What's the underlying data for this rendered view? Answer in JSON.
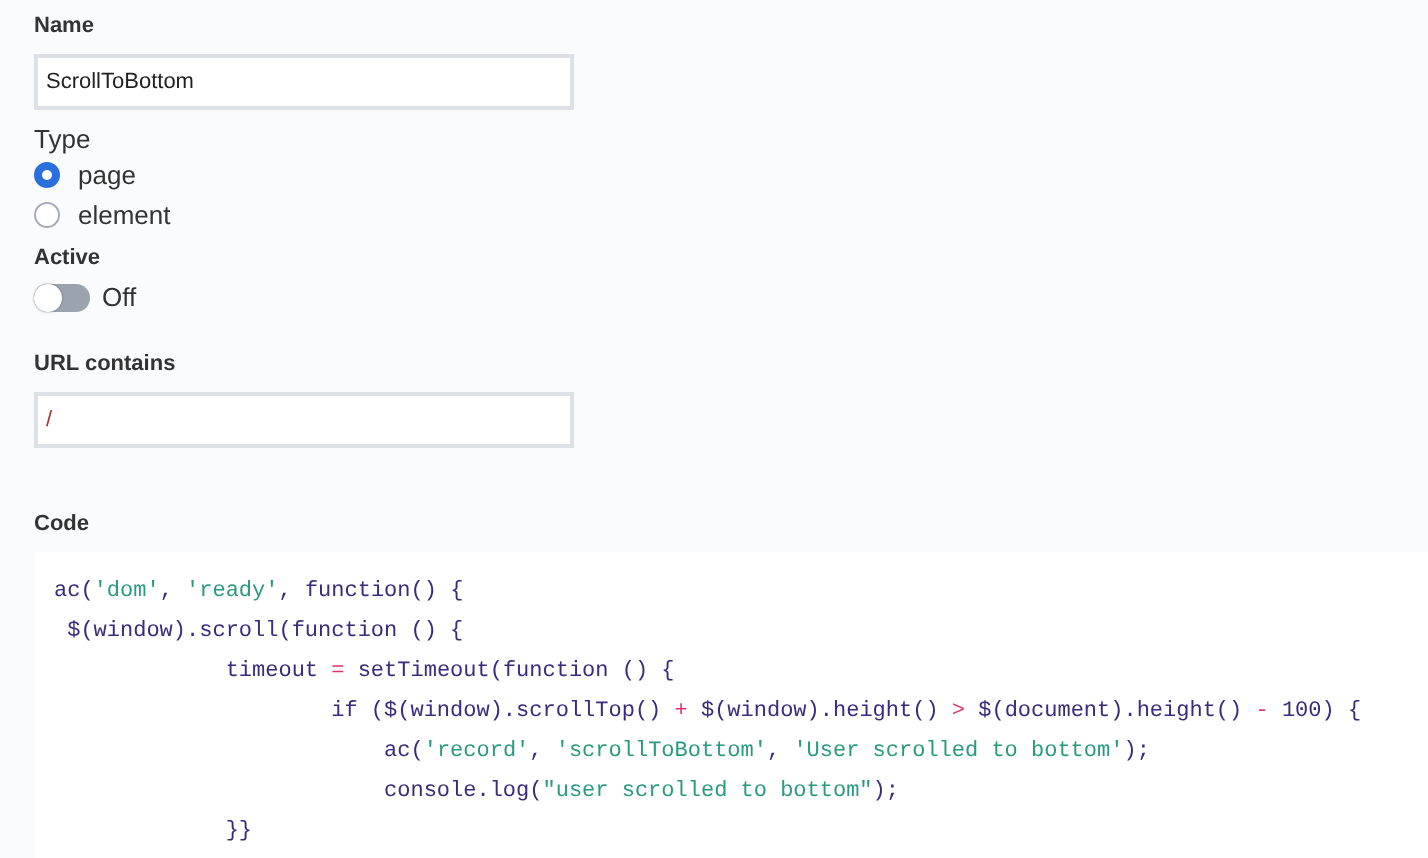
{
  "name_field": {
    "label": "Name",
    "value": "ScrollToBottom"
  },
  "type": {
    "label": "Type",
    "options": [
      {
        "label": "page",
        "selected": true
      },
      {
        "label": "element",
        "selected": false
      }
    ]
  },
  "active": {
    "label": "Active",
    "on": false,
    "state_text": "Off"
  },
  "url_field": {
    "label": "URL contains",
    "value": "/"
  },
  "code": {
    "label": "Code",
    "lines": [
      [
        {
          "text": "ac(",
          "kind": "plain"
        },
        {
          "text": "'dom'",
          "kind": "string"
        },
        {
          "text": ", ",
          "kind": "plain"
        },
        {
          "text": "'ready'",
          "kind": "string"
        },
        {
          "text": ", function() {",
          "kind": "plain"
        }
      ],
      [
        {
          "text": " $(window).scroll(function () {",
          "kind": "plain"
        }
      ],
      [
        {
          "text": "             timeout ",
          "kind": "plain"
        },
        {
          "text": "=",
          "kind": "operator"
        },
        {
          "text": " setTimeout(function () {",
          "kind": "plain"
        }
      ],
      [
        {
          "text": "                     if ($(window).scrollTop() ",
          "kind": "plain"
        },
        {
          "text": "+",
          "kind": "operator"
        },
        {
          "text": " $(window).height() ",
          "kind": "plain"
        },
        {
          "text": ">",
          "kind": "operator"
        },
        {
          "text": " $(document).height() ",
          "kind": "plain"
        },
        {
          "text": "-",
          "kind": "operator"
        },
        {
          "text": " 100) {",
          "kind": "plain"
        }
      ],
      [
        {
          "text": "                         ac(",
          "kind": "plain"
        },
        {
          "text": "'record'",
          "kind": "string"
        },
        {
          "text": ", ",
          "kind": "plain"
        },
        {
          "text": "'scrollToBottom'",
          "kind": "string"
        },
        {
          "text": ", ",
          "kind": "plain"
        },
        {
          "text": "'User scrolled to bottom'",
          "kind": "string"
        },
        {
          "text": ");",
          "kind": "plain"
        }
      ],
      [
        {
          "text": "                         console.log(",
          "kind": "plain"
        },
        {
          "text": "\"user scrolled to bottom\"",
          "kind": "string"
        },
        {
          "text": ");",
          "kind": "plain"
        }
      ],
      [
        {
          "text": "             }}",
          "kind": "plain"
        }
      ]
    ]
  }
}
